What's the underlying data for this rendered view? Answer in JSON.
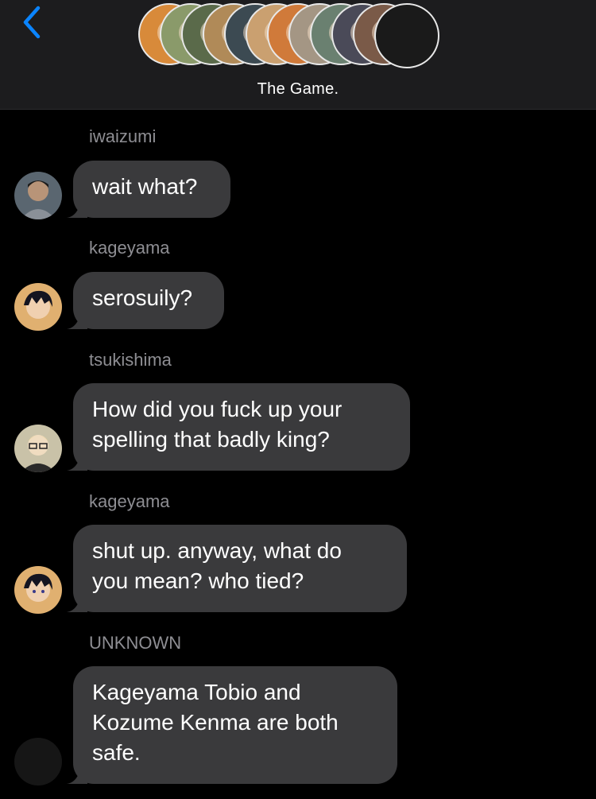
{
  "header": {
    "back_icon": "chevron-left-icon",
    "title": "The Game.",
    "participants": [
      {
        "color": "#d88a3a"
      },
      {
        "color": "#8a9a6a"
      },
      {
        "color": "#5a6a4a"
      },
      {
        "color": "#b08a58"
      },
      {
        "color": "#3c4a52"
      },
      {
        "color": "#caa070"
      },
      {
        "color": "#d07a3a"
      },
      {
        "color": "#a49684"
      },
      {
        "color": "#6a8070"
      },
      {
        "color": "#4a4a58"
      },
      {
        "color": "#7a5a48"
      },
      {
        "color": "#1a1a1a"
      }
    ]
  },
  "messages": [
    {
      "sender": "iwaizumi",
      "text": "wait what?",
      "avatar_color": "#5a6670"
    },
    {
      "sender": "kageyama",
      "text": "serosuily?",
      "avatar_color": "#e0b070"
    },
    {
      "sender": "tsukishima",
      "text": "How did you fuck up your\nspelling that badly king?",
      "avatar_color": "#c9c2a8"
    },
    {
      "sender": "kageyama",
      "text": "shut up. anyway, what do\nyou mean? who tied?",
      "avatar_color": "#e0b070"
    },
    {
      "sender": "UNKNOWN",
      "text": "Kageyama Tobio and\nKozume Kenma are both\nsafe.",
      "avatar_color": "#161616"
    }
  ],
  "colors": {
    "background": "#000000",
    "header_bg": "#1c1c1e",
    "bubble": "#3a3a3c",
    "sender_text": "#8e8e93",
    "accent": "#0a84ff"
  }
}
